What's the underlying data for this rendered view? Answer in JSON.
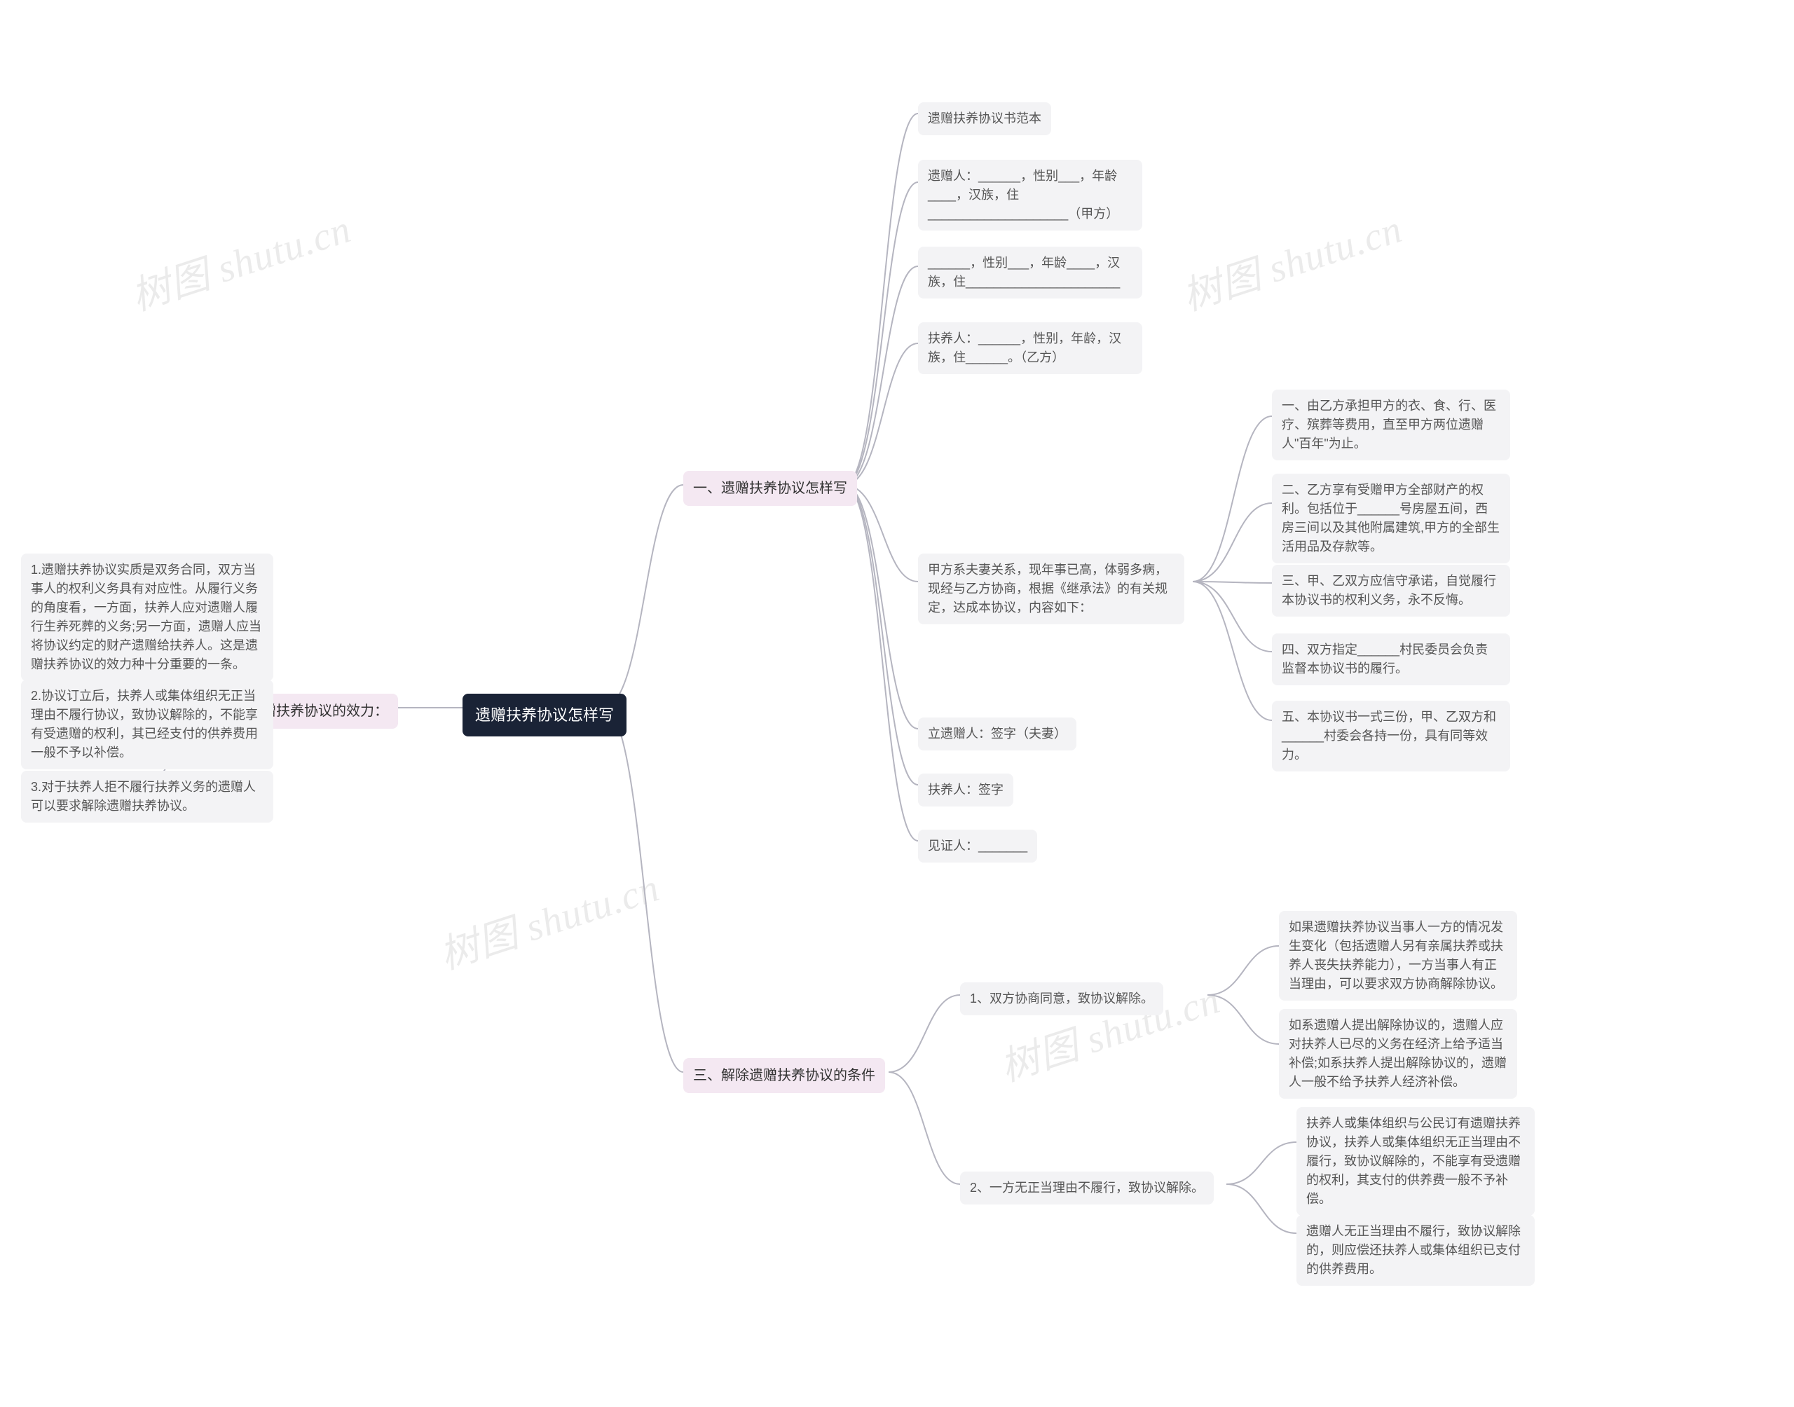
{
  "watermark": "树图 shutu.cn",
  "root": "遗赠扶养协议怎样写",
  "sections": {
    "s1": {
      "title": "一、遗赠扶养协议怎样写",
      "items": {
        "i1": "遗赠扶养协议书范本",
        "i2": "遗赠人：______，性别___，年龄____，汉族，住____________________（甲方）",
        "i3": "______，性别___，年龄____，汉族，住______________________",
        "i4": "扶养人：______，性别，年龄，汉族，住______。（乙方）",
        "i5": "甲方系夫妻关系，现年事已高，体弱多病，现经与乙方协商，根据《继承法》的有关规定，达成本协议，内容如下：",
        "i6": "立遗赠人：签字（夫妻）",
        "i7": "扶养人：签字",
        "i8": "见证人：_______",
        "clauses": {
          "c1": "一、由乙方承担甲方的衣、食、行、医疗、殡葬等费用，直至甲方两位遗赠人\"百年\"为止。",
          "c2": "二、乙方享有受赠甲方全部财产的权利。包括位于______号房屋五间，西房三间以及其他附属建筑,甲方的全部生活用品及存款等。",
          "c3": "三、甲、乙双方应信守承诺，自觉履行本协议书的权利义务，永不反悔。",
          "c4": "四、双方指定______村民委员会负责监督本协议书的履行。",
          "c5": "五、本协议书一式三份，甲、乙双方和______村委会各持一份，具有同等效力。"
        }
      }
    },
    "s2": {
      "title": "二、遗赠扶养协议的效力：",
      "items": {
        "i1": "1.遗赠扶养协议实质是双务合同，双方当事人的权利义务具有对应性。从履行义务的角度看，一方面，扶养人应对遗赠人履行生养死葬的义务;另一方面，遗赠人应当将协议约定的财产遗赠给扶养人。这是遗赠扶养协议的效力种十分重要的一条。",
        "i2": "2.协议订立后，扶养人或集体组织无正当理由不履行协议，致协议解除的，不能享有受遗赠的权利，其已经支付的供养费用一般不予以补偿。",
        "i3": "3.对于扶养人拒不履行扶养义务的遗赠人可以要求解除遗赠扶养协议。"
      }
    },
    "s3": {
      "title": "三、解除遗赠扶养协议的条件",
      "items": {
        "i1": "1、双方协商同意，致协议解除。",
        "i2": "2、一方无正当理由不履行，致协议解除。",
        "sub1": {
          "a": "如果遗赠扶养协议当事人一方的情况发生变化（包括遗赠人另有亲属扶养或扶养人丧失扶养能力），一方当事人有正当理由，可以要求双方协商解除协议。",
          "b": "如系遗赠人提出解除协议的，遗赠人应对扶养人已尽的义务在经济上给予适当补偿;如系扶养人提出解除协议的，遗赠人一般不给予扶养人经济补偿。"
        },
        "sub2": {
          "a": "扶养人或集体组织与公民订有遗赠扶养协议，扶养人或集体组织无正当理由不履行，致协议解除的，不能享有受遗赠的权利，其支付的供养费一般不予补偿。",
          "b": "遗赠人无正当理由不履行，致协议解除的，则应偿还扶养人或集体组织已支付的供养费用。"
        }
      }
    }
  }
}
